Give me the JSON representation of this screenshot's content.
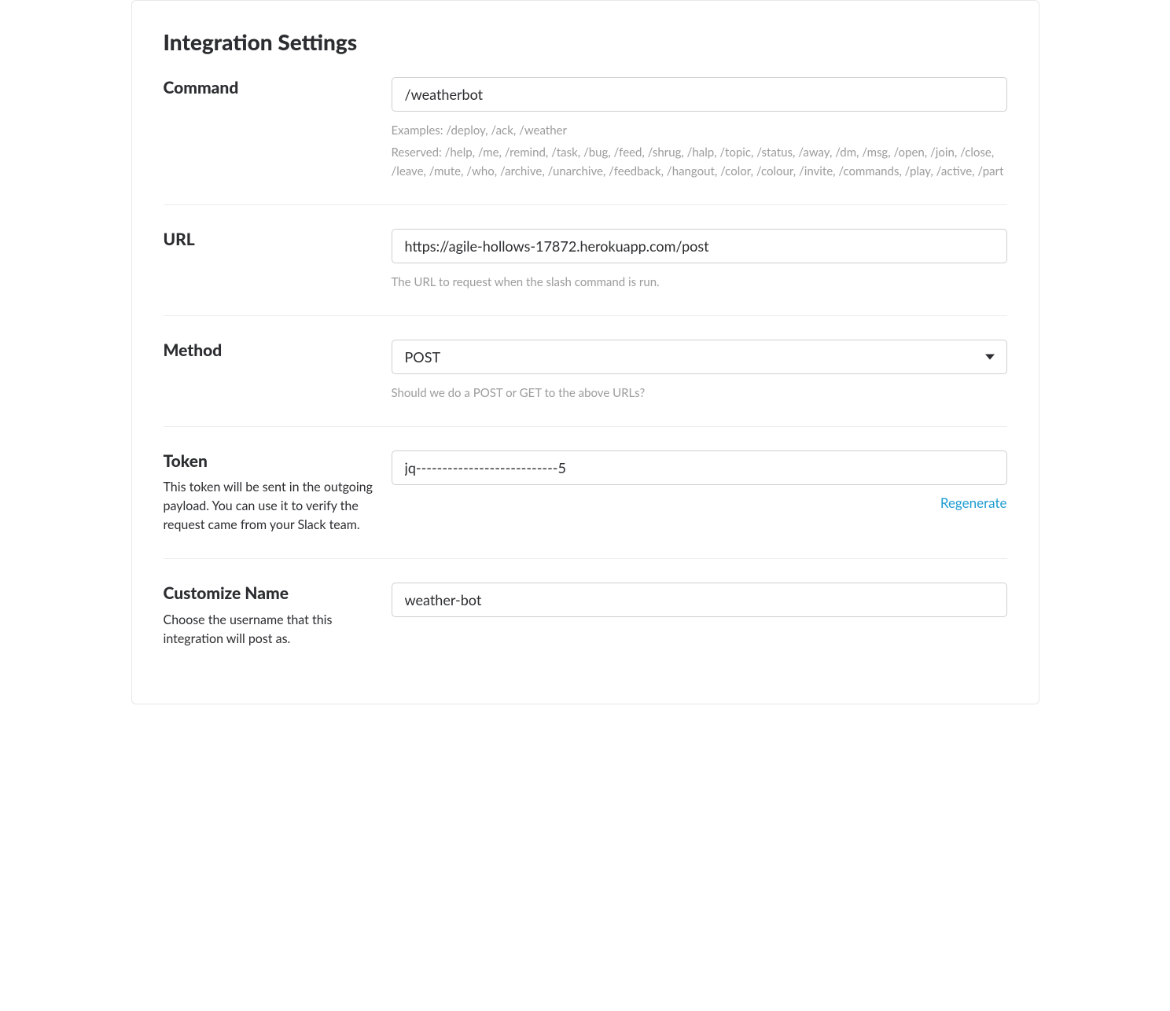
{
  "title": "Integration Settings",
  "command": {
    "label": "Command",
    "value": "/weatherbot",
    "help_examples": "Examples: /deploy, /ack, /weather",
    "help_reserved": "Reserved: /help, /me, /remind, /task, /bug, /feed, /shrug, /halp, /topic, /status, /away, /dm, /msg, /open, /join, /close, /leave, /mute, /who, /archive, /unarchive, /feedback, /hangout, /color, /colour, /invite, /commands, /play, /active, /part"
  },
  "url": {
    "label": "URL",
    "value": "https://agile-hollows-17872.herokuapp.com/post",
    "help": "The URL to request when the slash command is run."
  },
  "method": {
    "label": "Method",
    "value": "POST",
    "help": "Should we do a POST or GET to the above URLs?"
  },
  "token": {
    "label": "Token",
    "desc": "This token will be sent in the outgoing payload. You can use it to verify the request came from your Slack team.",
    "value": "jq---------------------------5",
    "regenerate_label": "Regenerate"
  },
  "customize_name": {
    "label": "Customize Name",
    "desc": "Choose the username that this integration will post as.",
    "value": "weather-bot"
  }
}
